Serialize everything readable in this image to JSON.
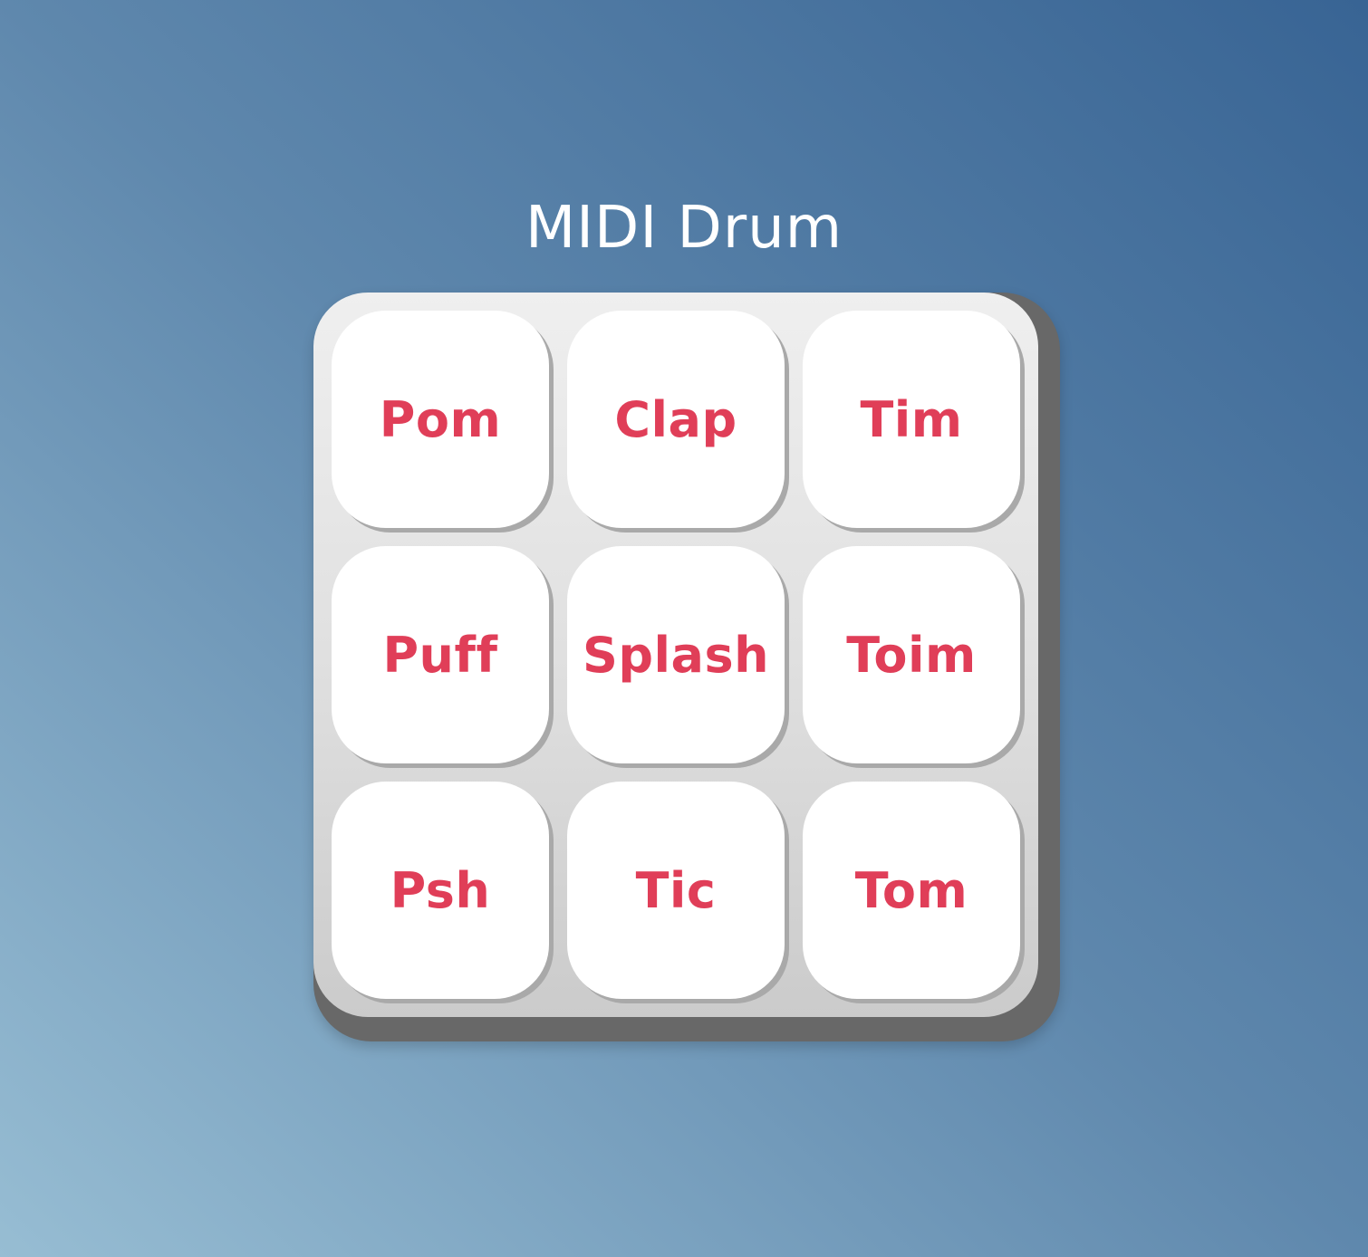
{
  "app": {
    "title": "MIDI Drum"
  },
  "pads": [
    {
      "label": "Pom"
    },
    {
      "label": "Clap"
    },
    {
      "label": "Tim"
    },
    {
      "label": "Puff"
    },
    {
      "label": "Splash"
    },
    {
      "label": "Toim"
    },
    {
      "label": "Psh"
    },
    {
      "label": "Tic"
    },
    {
      "label": "Tom"
    }
  ],
  "colors": {
    "pad_label": "#e03e58",
    "pad_background": "#ffffff",
    "board_background": "#e0e0e0",
    "board_shadow": "#686868"
  }
}
